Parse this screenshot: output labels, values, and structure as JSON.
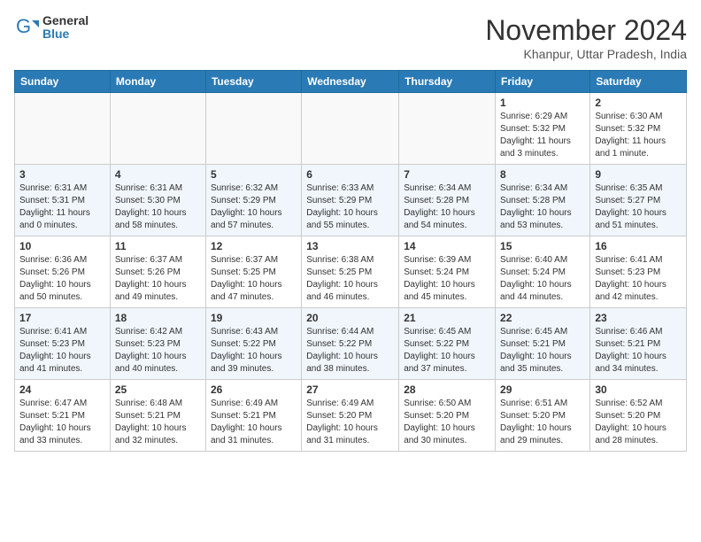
{
  "header": {
    "logo_general": "General",
    "logo_blue": "Blue",
    "month_title": "November 2024",
    "location": "Khanpur, Uttar Pradesh, India"
  },
  "calendar": {
    "days_of_week": [
      "Sunday",
      "Monday",
      "Tuesday",
      "Wednesday",
      "Thursday",
      "Friday",
      "Saturday"
    ],
    "weeks": [
      [
        {
          "day": "",
          "empty": true
        },
        {
          "day": "",
          "empty": true
        },
        {
          "day": "",
          "empty": true
        },
        {
          "day": "",
          "empty": true
        },
        {
          "day": "",
          "empty": true
        },
        {
          "day": "1",
          "sunrise": "6:29 AM",
          "sunset": "5:32 PM",
          "daylight": "11 hours and 3 minutes."
        },
        {
          "day": "2",
          "sunrise": "6:30 AM",
          "sunset": "5:32 PM",
          "daylight": "11 hours and 1 minute."
        }
      ],
      [
        {
          "day": "3",
          "sunrise": "6:31 AM",
          "sunset": "5:31 PM",
          "daylight": "11 hours and 0 minutes."
        },
        {
          "day": "4",
          "sunrise": "6:31 AM",
          "sunset": "5:30 PM",
          "daylight": "10 hours and 58 minutes."
        },
        {
          "day": "5",
          "sunrise": "6:32 AM",
          "sunset": "5:29 PM",
          "daylight": "10 hours and 57 minutes."
        },
        {
          "day": "6",
          "sunrise": "6:33 AM",
          "sunset": "5:29 PM",
          "daylight": "10 hours and 55 minutes."
        },
        {
          "day": "7",
          "sunrise": "6:34 AM",
          "sunset": "5:28 PM",
          "daylight": "10 hours and 54 minutes."
        },
        {
          "day": "8",
          "sunrise": "6:34 AM",
          "sunset": "5:28 PM",
          "daylight": "10 hours and 53 minutes."
        },
        {
          "day": "9",
          "sunrise": "6:35 AM",
          "sunset": "5:27 PM",
          "daylight": "10 hours and 51 minutes."
        }
      ],
      [
        {
          "day": "10",
          "sunrise": "6:36 AM",
          "sunset": "5:26 PM",
          "daylight": "10 hours and 50 minutes."
        },
        {
          "day": "11",
          "sunrise": "6:37 AM",
          "sunset": "5:26 PM",
          "daylight": "10 hours and 49 minutes."
        },
        {
          "day": "12",
          "sunrise": "6:37 AM",
          "sunset": "5:25 PM",
          "daylight": "10 hours and 47 minutes."
        },
        {
          "day": "13",
          "sunrise": "6:38 AM",
          "sunset": "5:25 PM",
          "daylight": "10 hours and 46 minutes."
        },
        {
          "day": "14",
          "sunrise": "6:39 AM",
          "sunset": "5:24 PM",
          "daylight": "10 hours and 45 minutes."
        },
        {
          "day": "15",
          "sunrise": "6:40 AM",
          "sunset": "5:24 PM",
          "daylight": "10 hours and 44 minutes."
        },
        {
          "day": "16",
          "sunrise": "6:41 AM",
          "sunset": "5:23 PM",
          "daylight": "10 hours and 42 minutes."
        }
      ],
      [
        {
          "day": "17",
          "sunrise": "6:41 AM",
          "sunset": "5:23 PM",
          "daylight": "10 hours and 41 minutes."
        },
        {
          "day": "18",
          "sunrise": "6:42 AM",
          "sunset": "5:23 PM",
          "daylight": "10 hours and 40 minutes."
        },
        {
          "day": "19",
          "sunrise": "6:43 AM",
          "sunset": "5:22 PM",
          "daylight": "10 hours and 39 minutes."
        },
        {
          "day": "20",
          "sunrise": "6:44 AM",
          "sunset": "5:22 PM",
          "daylight": "10 hours and 38 minutes."
        },
        {
          "day": "21",
          "sunrise": "6:45 AM",
          "sunset": "5:22 PM",
          "daylight": "10 hours and 37 minutes."
        },
        {
          "day": "22",
          "sunrise": "6:45 AM",
          "sunset": "5:21 PM",
          "daylight": "10 hours and 35 minutes."
        },
        {
          "day": "23",
          "sunrise": "6:46 AM",
          "sunset": "5:21 PM",
          "daylight": "10 hours and 34 minutes."
        }
      ],
      [
        {
          "day": "24",
          "sunrise": "6:47 AM",
          "sunset": "5:21 PM",
          "daylight": "10 hours and 33 minutes."
        },
        {
          "day": "25",
          "sunrise": "6:48 AM",
          "sunset": "5:21 PM",
          "daylight": "10 hours and 32 minutes."
        },
        {
          "day": "26",
          "sunrise": "6:49 AM",
          "sunset": "5:21 PM",
          "daylight": "10 hours and 31 minutes."
        },
        {
          "day": "27",
          "sunrise": "6:49 AM",
          "sunset": "5:20 PM",
          "daylight": "10 hours and 31 minutes."
        },
        {
          "day": "28",
          "sunrise": "6:50 AM",
          "sunset": "5:20 PM",
          "daylight": "10 hours and 30 minutes."
        },
        {
          "day": "29",
          "sunrise": "6:51 AM",
          "sunset": "5:20 PM",
          "daylight": "10 hours and 29 minutes."
        },
        {
          "day": "30",
          "sunrise": "6:52 AM",
          "sunset": "5:20 PM",
          "daylight": "10 hours and 28 minutes."
        }
      ]
    ]
  }
}
